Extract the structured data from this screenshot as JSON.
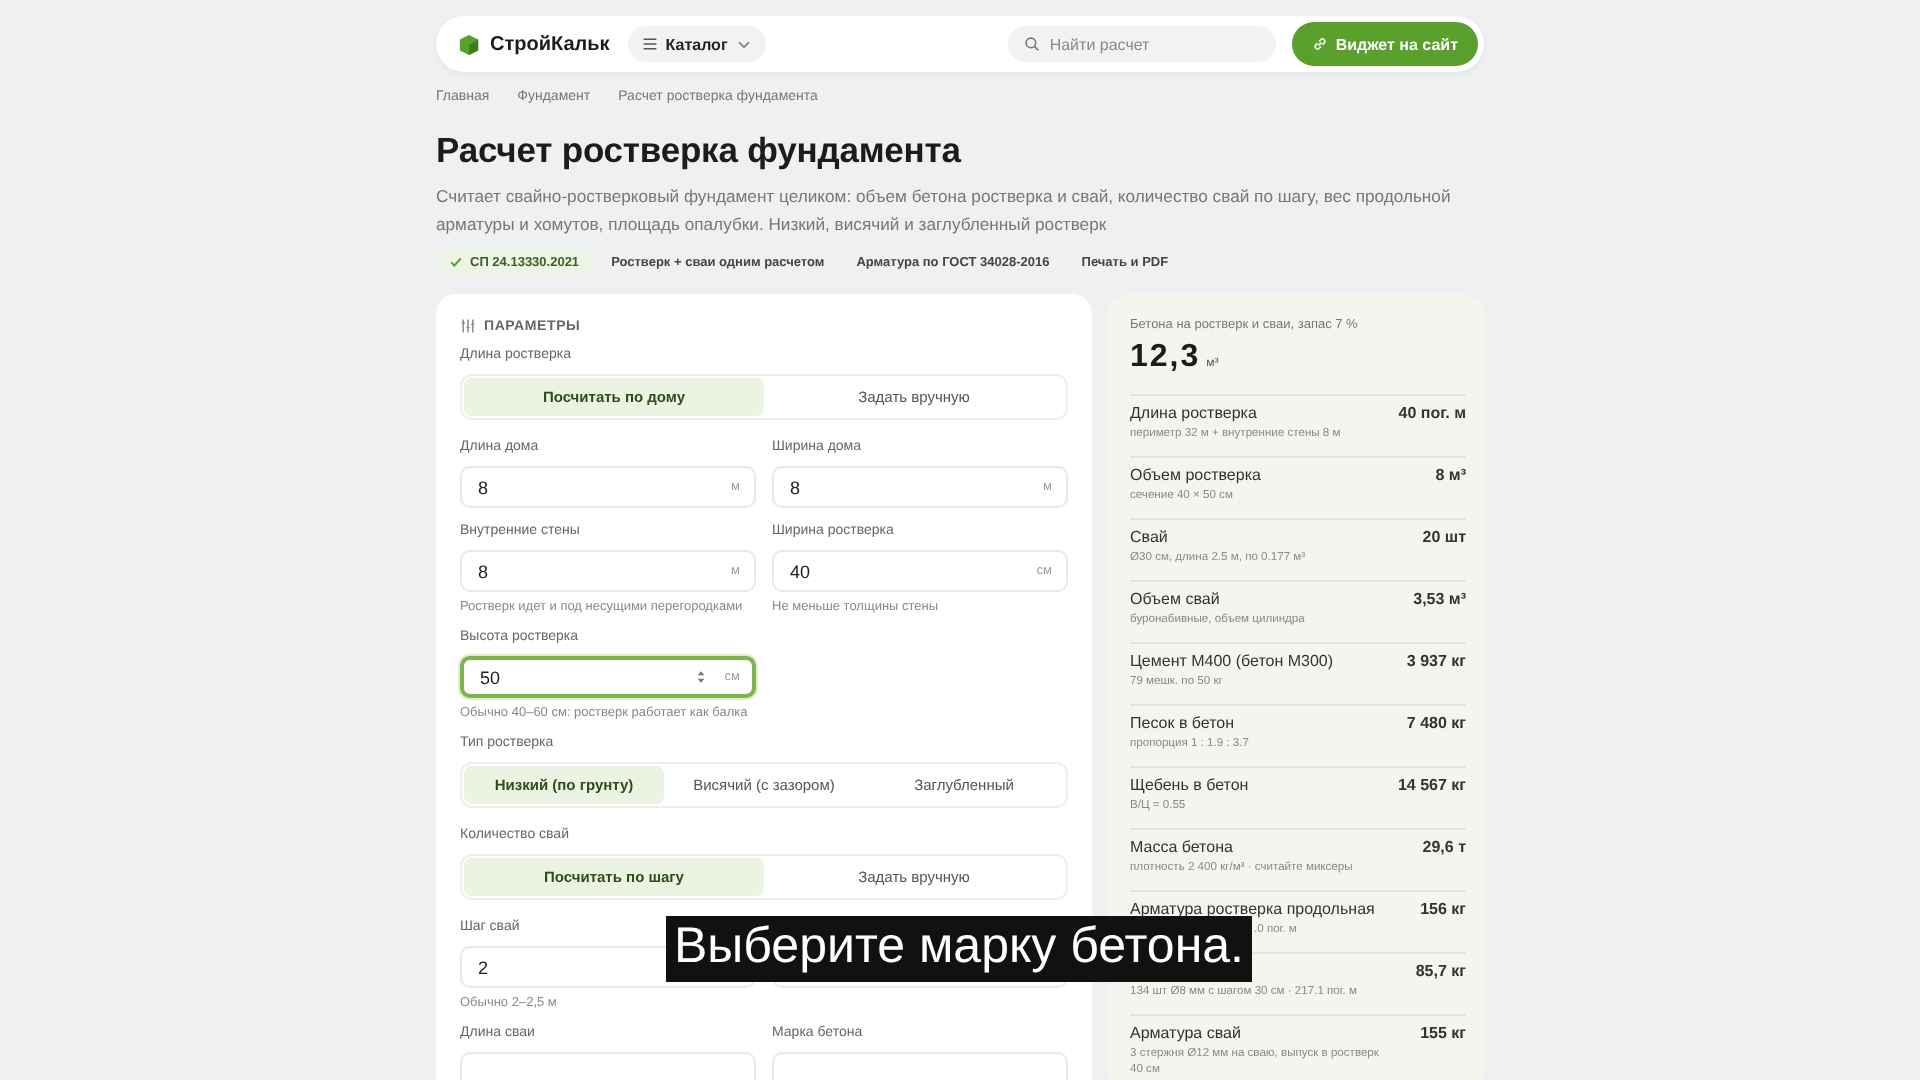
{
  "header": {
    "logo_text": "СтройКальк",
    "catalog_button": "Каталог",
    "search": {
      "placeholder": "Найти расчет"
    },
    "widget_button": "Виджет на сайт"
  },
  "breadcrumbs": [
    "Главная",
    "Фундамент",
    "Расчет ростверка фундамента"
  ],
  "title": "Расчет ростверка фундамента",
  "description": "Считает свайно-ростверковый фундамент целиком: объем бетона ростверка и свай, количество свай по шагу, вес продольной арматуры и хомутов, площадь опалубки. Низкий, висячий и заглубленный ростверк",
  "tags": [
    {
      "label": "СП 24.13330.2021",
      "verified": true
    },
    {
      "label": "Ростверк + сваи одним расчетом",
      "verified": false
    },
    {
      "label": "Арматура по ГОСТ 34028-2016",
      "verified": false
    },
    {
      "label": "Печать и PDF",
      "verified": false
    }
  ],
  "form": {
    "heading": "ПАРАМЕТРЫ",
    "items": [
      {
        "kind": "segmented",
        "label": "Длина ростверка",
        "options": [
          {
            "label": "Посчитать по дому",
            "selected": true
          },
          {
            "label": "Задать вручную",
            "selected": false
          }
        ]
      },
      {
        "kind": "inputs",
        "fields": [
          {
            "label": "Длина дома",
            "value": "8",
            "unit": "м",
            "focused": false
          },
          {
            "label": "Ширина дома",
            "value": "8",
            "unit": "м",
            "focused": false
          }
        ]
      },
      {
        "kind": "inputs",
        "fields": [
          {
            "label": "Внутренние стены",
            "value": "8",
            "unit": "м",
            "hint": "Ростверк идет и под несущими перегородками",
            "focused": false
          },
          {
            "label": "Ширина ростверка",
            "value": "40",
            "unit": "см",
            "hint": "Не меньше толщины стены",
            "focused": false
          }
        ]
      },
      {
        "kind": "inputs",
        "fields": [
          {
            "label": "Высота ростверка",
            "value": "50",
            "unit": "см",
            "hint": "Обычно 40–60 см: ростверк работает как балка",
            "focused": true
          }
        ]
      },
      {
        "kind": "segmented",
        "label": "Тип ростверка",
        "options": [
          {
            "label": "Низкий (по грунту)",
            "selected": true
          },
          {
            "label": "Висячий (с зазором)",
            "selected": false
          },
          {
            "label": "Заглубленный",
            "selected": false
          }
        ]
      },
      {
        "kind": "segmented",
        "label": "Количество свай",
        "options": [
          {
            "label": "Посчитать по шагу",
            "selected": true
          },
          {
            "label": "Задать вручную",
            "selected": false
          }
        ]
      },
      {
        "kind": "inputs",
        "fields": [
          {
            "label": "Шаг свай",
            "value": "2",
            "hint": "Обычно 2–2,5 м",
            "focused": false
          },
          {
            "focused": false
          }
        ]
      },
      {
        "kind": "inputs",
        "fields": [
          {
            "label": "Длина сваи",
            "focused": false
          },
          {
            "label": "Марка бетона",
            "focused": false
          }
        ]
      }
    ]
  },
  "results": {
    "summary_label": "Бетона на ростверк и сваи, запас 7 %",
    "total_value": "12,3",
    "total_unit": "м³",
    "rows": [
      {
        "kind": "plain",
        "name": "Длина ростверка",
        "note": "периметр 32 м + внутренние стены 8 м",
        "value": "40 пог. м"
      },
      {
        "kind": "plain",
        "name": "Объем ростверка",
        "note": "сечение 40 × 50 см",
        "value": "8 м³"
      },
      {
        "kind": "plain",
        "name": "Свай",
        "note": "Ø30 см, длина 2.5 м, по 0.177 м³",
        "value": "20 шт"
      },
      {
        "kind": "plain",
        "name": "Объем свай",
        "note": "буронабивные, объем цилиндра",
        "value": "3,53 м³"
      },
      {
        "kind": "plain",
        "name": "Цемент М400 (бетон М300)",
        "note": "79 мешк. по 50 кг",
        "value": "3 937 кг"
      },
      {
        "kind": "plain",
        "name": "Песок в бетон",
        "note": "пропорция 1 : 1.9 : 3.7",
        "value": "7 480 кг"
      },
      {
        "kind": "plain",
        "name": "Щебень в бетон",
        "note": "В/Ц = 0.55",
        "value": "14 567 кг"
      },
      {
        "kind": "plain",
        "name": "Масса бетона",
        "note": "плотность 2 400 кг/м³ · считайте миксеры",
        "value": "29,6 т"
      },
      {
        "kind": "clipped",
        "name": "Арматура ростверка продольная",
        "note": ".0 пог. м",
        "value": "156 кг"
      },
      {
        "kind": "plain",
        "note": "134 шт Ø8 мм с шагом 30 см · 217.1 пог. м",
        "value": "85,7 кг"
      },
      {
        "kind": "plain",
        "name": "Арматура свай",
        "note": "3 стержня Ø12 мм на сваю, выпуск в ростверк 40 см",
        "value": "155 кг"
      }
    ]
  },
  "subtitle": "Выберите марку бетона."
}
